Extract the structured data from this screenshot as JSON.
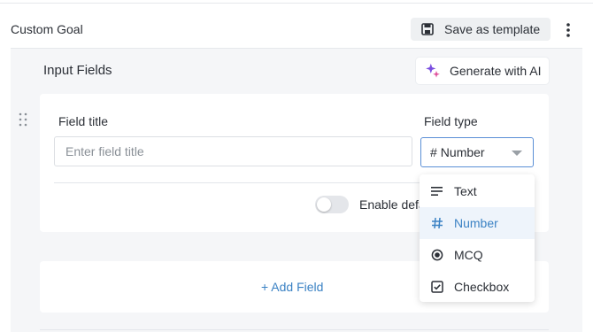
{
  "header": {
    "title": "Custom Goal",
    "save_template_label": "Save as template"
  },
  "section": {
    "title": "Input Fields",
    "generate_label": "Generate with AI"
  },
  "field": {
    "title_label": "Field title",
    "title_placeholder": "Enter field title",
    "type_label": "Field type",
    "type_value": "Number",
    "type_value_icon": "#",
    "default_toggle_label": "Enable defa",
    "default_toggle_on": false
  },
  "add_field": {
    "label": "+ Add Field"
  },
  "dropdown": {
    "selected": "Number",
    "options": [
      {
        "label": "Text",
        "icon": "text-lines-icon"
      },
      {
        "label": "Number",
        "icon": "hash-icon"
      },
      {
        "label": "MCQ",
        "icon": "radio-icon"
      },
      {
        "label": "Checkbox",
        "icon": "checkbox-icon"
      }
    ]
  },
  "colors": {
    "accent": "#3b82c4",
    "panel_bg": "#f5f6f8",
    "selected_bg": "#eef4fb",
    "ai_icon": "#7b4fe0"
  }
}
